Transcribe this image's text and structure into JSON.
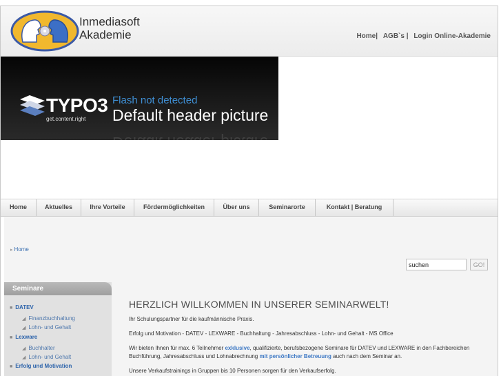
{
  "header": {
    "brand_line1": "Inmediasoft",
    "brand_line2": "Akademie",
    "links": [
      "Home|",
      "AGB`s |",
      "Login Online-Akademie"
    ]
  },
  "banner": {
    "logo_word": "TYPO3",
    "logo_tagline": "get.content.right",
    "flash_text": "Flash not detected",
    "header_text": "Default header picture"
  },
  "nav": {
    "items": [
      "Home",
      "Aktuelles",
      "Ihre Vorteile",
      "Fördermöglichkeiten",
      "Über uns",
      "Seminarorte",
      "Kontakt | Beratung"
    ]
  },
  "breadcrumb": {
    "label": "Home"
  },
  "search": {
    "value": "suchen",
    "button": "GO!"
  },
  "sidebar": {
    "title": "Seminare",
    "items": [
      {
        "label": "DATEV",
        "level": 1
      },
      {
        "label": "Finanzbuchhaltung",
        "level": 2
      },
      {
        "label": "Lohn- und Gehalt",
        "level": 2
      },
      {
        "label": "Lexware",
        "level": 1
      },
      {
        "label": "Buchhalter",
        "level": 2
      },
      {
        "label": "Lohn- und Gehalt",
        "level": 2
      },
      {
        "label": "Erfolg und Motivation",
        "level": 1
      }
    ]
  },
  "main": {
    "title": "HERZLICH WILLKOMMEN IN UNSERER SEMINARWELT!",
    "p1": "Ihr Schulungspartner für die kaufmännische Praxis.",
    "p2": "Erfolg und Motivation - DATEV - LEXWARE - Buchhaltung - Jahresabschluss - Lohn- und Gehalt - MS Office",
    "p3_before": "Wir bieten Ihnen für max. 6 Teilnehmer ",
    "p3_em1": "exklusive",
    "p3_mid": ", qualifizierte, berufsbezogene Seminare für DATEV und LEXWARE in den Fachbereichen Buchführung, Jahresabschluss und Lohnabrechnung ",
    "p3_em2": "mit persönlicher Betreuung",
    "p3_after": " auch nach dem Seminar an.",
    "p4": "Unsere Verkaufstrainings in Gruppen bis 10 Personen sorgen für den Verkaufserfolg."
  },
  "colors": {
    "link_blue": "#2f65ab",
    "accent_blue": "#3d78c4",
    "sidebar_head": "#aaaaaa"
  }
}
